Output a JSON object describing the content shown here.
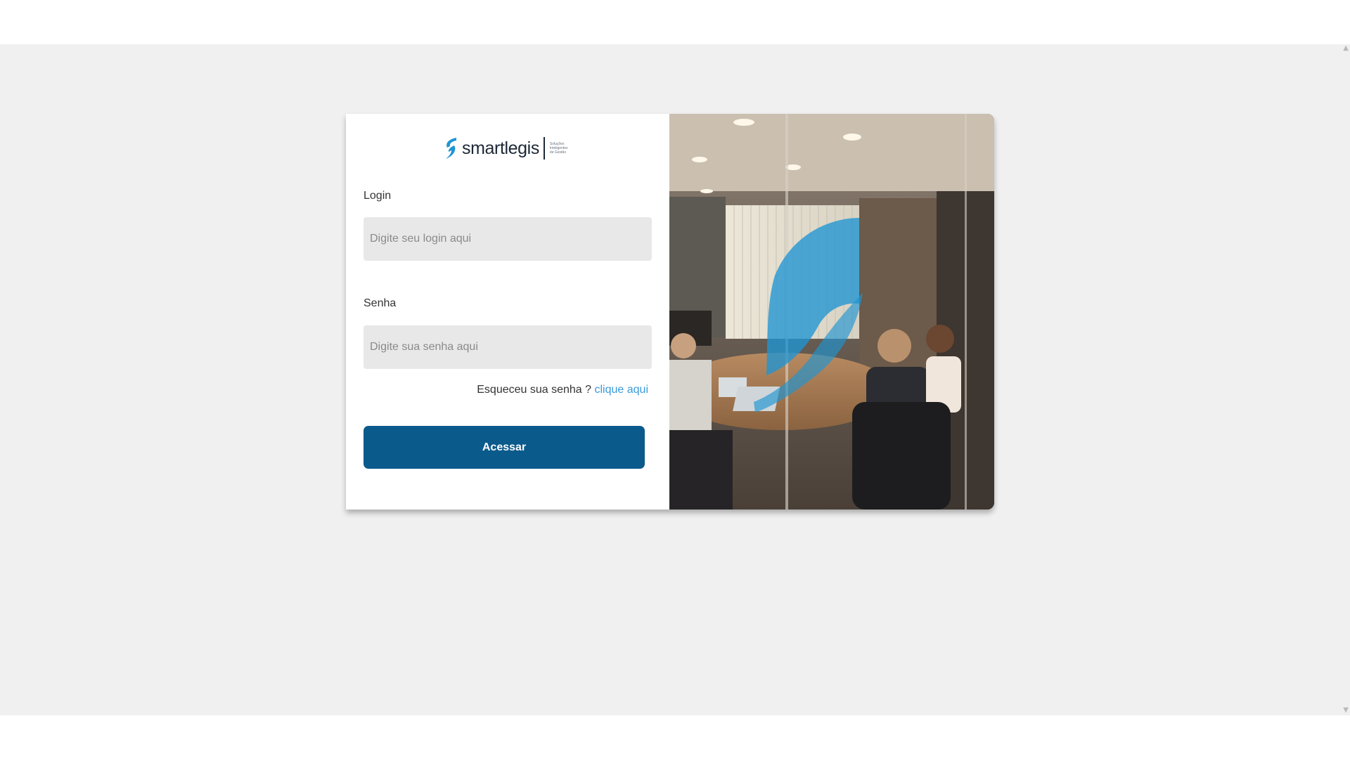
{
  "brand": {
    "name": "smartlegis",
    "tagline": [
      "Soluções",
      "Inteligentes",
      "de Gestão"
    ],
    "accent_color": "#1f95d3",
    "dark_color": "#1c2836"
  },
  "login_form": {
    "login_label": "Login",
    "login_placeholder": "Digite seu login aqui",
    "password_label": "Senha",
    "password_placeholder": "Digite sua senha aqui",
    "forgot_text": "Esqueceu sua senha ?",
    "forgot_link": "clique aqui",
    "submit_label": "Acessar",
    "button_color": "#0a5a8c",
    "link_color": "#3a9ad9"
  },
  "hero_image": {
    "description_icon": "office-meeting-photo"
  },
  "scrollbar": {
    "up_icon": "scroll-up-arrow-icon",
    "down_icon": "scroll-down-arrow-icon"
  }
}
